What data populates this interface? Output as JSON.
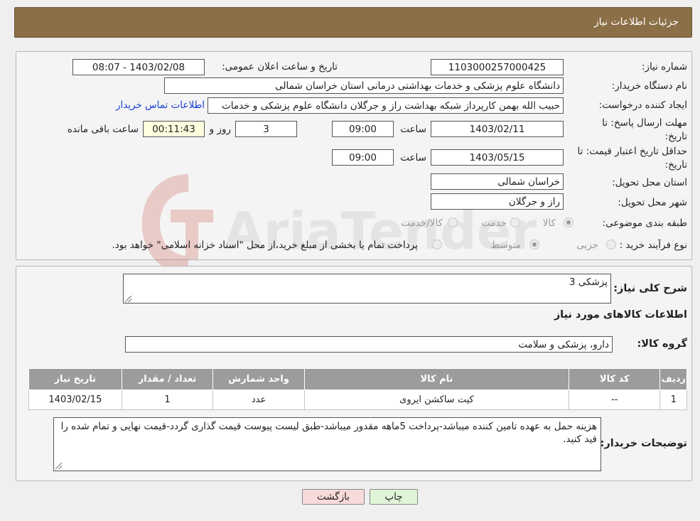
{
  "header": {
    "title": "جزئیات اطلاعات نیاز"
  },
  "watermark": {
    "text": "AriaTender.neT"
  },
  "form": {
    "need_number_label": "شماره نیاز:",
    "need_number": "1103000257000425",
    "announce_label": "تاریخ و ساعت اعلان عمومی:",
    "announce_value": "1403/02/08 - 08:07",
    "buyer_org_label": "نام دستگاه خریدار:",
    "buyer_org": "دانشگاه علوم پزشکی و خدمات بهداشتی درمانی استان خراسان شمالی",
    "creator_label": "ایجاد کننده درخواست:",
    "creator": "حبیب الله بهمن کارپرداز شبکه بهداشت راز و جرگلان دانشگاه علوم پزشکی و خدمات",
    "contact_link": "اطلاعات تماس خریدار",
    "deadline_label_1": "مهلت ارسال پاسخ: تا",
    "deadline_label_2": "تاریخ:",
    "deadline_date": "1403/02/11",
    "time_label": "ساعت",
    "deadline_time": "09:00",
    "days_value": "3",
    "days_label": "روز و",
    "remaining_value": "00:11:43",
    "remaining_label": "ساعت باقی مانده",
    "validity_label_1": "حداقل تاریخ اعتبار قیمت: تا",
    "validity_label_2": "تاریخ:",
    "validity_date": "1403/05/15",
    "validity_time": "09:00",
    "province_label": "استان محل تحویل:",
    "province": "خراسان شمالی",
    "city_label": "شهر محل تحویل:",
    "city": "راز و جرگلان",
    "category_label": "طبقه بندی موضوعی:",
    "category_options": [
      "کالا",
      "خدمت",
      "کالا/خدمت"
    ],
    "category_selected": "کالا",
    "process_label": "نوع فرآیند خرید :",
    "process_options": [
      "جزیی",
      "متوسط"
    ],
    "process_selected": "متوسط",
    "payment_note": "پرداخت تمام یا بخشی از مبلغ خرید،از محل \"اسناد خزانه اسلامی\" خواهد بود."
  },
  "details": {
    "summary_label": "شرح کلی نیاز:",
    "summary": "پزشکی 3",
    "goods_info_title": "اطلاعات کالاهای مورد نیاز",
    "group_label": "گروه کالا:",
    "group": "دارو، پزشکی و سلامت",
    "table": {
      "headers": [
        "ردیف",
        "کد کالا",
        "نام کالا",
        "واحد شمارش",
        "تعداد / مقدار",
        "تاریخ نیاز"
      ],
      "rows": [
        [
          "1",
          "--",
          "کیت ساکشن ایروی",
          "عدد",
          "1",
          "1403/02/15"
        ]
      ]
    },
    "buyer_notes_label": "توضیحات خریدار:",
    "buyer_notes": "هزینه حمل به عهده تامین کننده میباشد-پرداخت 5ماهه مقدور میباشد-طبق لیست پیوست قیمت گذاری گردد-قیمت نهایی و تمام شده را قید کنید."
  },
  "buttons": {
    "print": "چاپ",
    "back": "بازگشت"
  },
  "colors": {
    "header": "#8b6f47",
    "back_button": "#f8dada",
    "print_button": "#e0f5d8"
  }
}
